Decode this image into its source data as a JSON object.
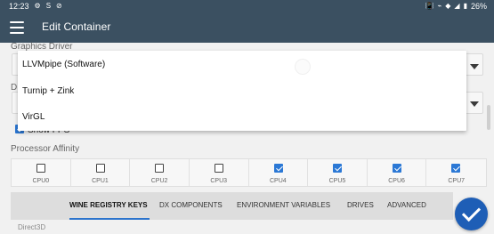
{
  "status_bar": {
    "time": "12:23",
    "left_icons": [
      "settings-icon",
      "sync-icon",
      "block-icon"
    ],
    "right_icons": [
      "vibrate-icon",
      "network-icon",
      "wifi-icon",
      "signal-icon",
      "battery-icon"
    ],
    "battery_percent": "26%"
  },
  "app_bar": {
    "title": "Edit Container"
  },
  "form": {
    "graphics_driver_label": "Graphics Driver",
    "dx_wrapper_label": "D",
    "show_fps_label": "Show FPS",
    "processor_affinity_label": "Processor Affinity"
  },
  "dropdown": {
    "options": [
      "LLVMpipe (Software)",
      "Turnip + Zink",
      "VirGL"
    ]
  },
  "cpus": [
    {
      "label": "CPU0",
      "checked": false
    },
    {
      "label": "CPU1",
      "checked": false
    },
    {
      "label": "CPU2",
      "checked": false
    },
    {
      "label": "CPU3",
      "checked": false
    },
    {
      "label": "CPU4",
      "checked": true
    },
    {
      "label": "CPU5",
      "checked": true
    },
    {
      "label": "CPU6",
      "checked": true
    },
    {
      "label": "CPU7",
      "checked": true
    }
  ],
  "tabs": [
    {
      "label": "WINE REGISTRY KEYS",
      "active": true
    },
    {
      "label": "DX COMPONENTS",
      "active": false
    },
    {
      "label": "ENVIRONMENT VARIABLES",
      "active": false
    },
    {
      "label": "DRIVES",
      "active": false
    },
    {
      "label": "ADVANCED",
      "active": false
    }
  ],
  "section": {
    "direct3d_label": "Direct3D"
  },
  "colors": {
    "app_bar": "#3b5061",
    "accent": "#2b78d5",
    "fab": "#1e5eb6"
  }
}
